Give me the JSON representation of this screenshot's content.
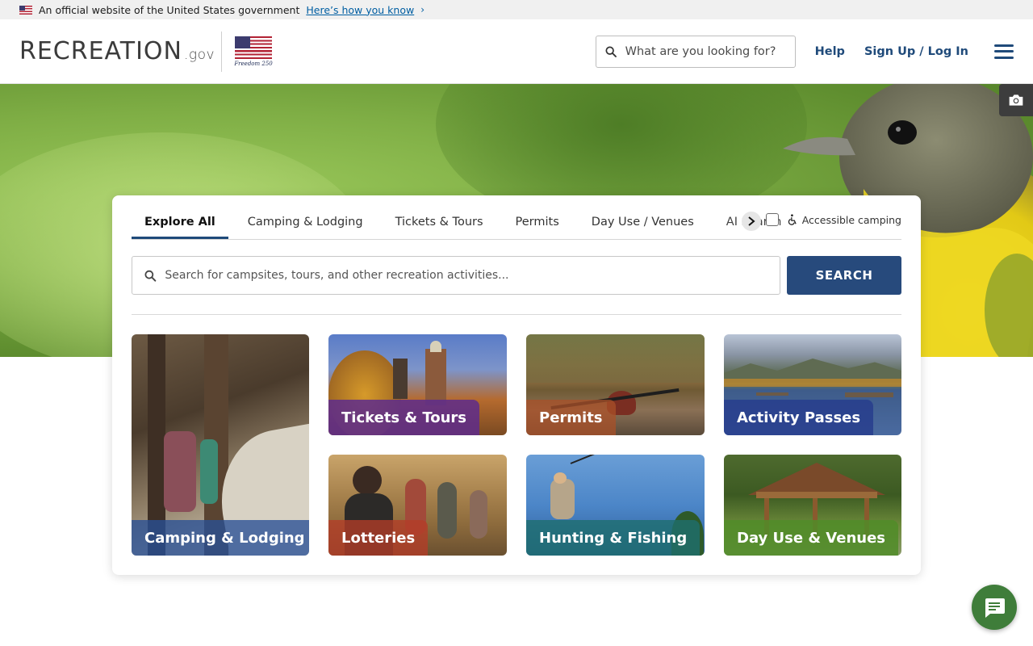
{
  "gov_banner": {
    "text": "An official website of the United States government",
    "link": "Here’s how you know"
  },
  "header": {
    "logo_main": "RECREATION",
    "logo_suffix": ".gov",
    "freedom_label": "Freedom 250",
    "search_placeholder": "What are you looking for?",
    "help": "Help",
    "signup": "Sign Up / Log In"
  },
  "search_card": {
    "tabs": [
      {
        "label": "Explore All",
        "active": true
      },
      {
        "label": "Camping & Lodging"
      },
      {
        "label": "Tickets & Tours"
      },
      {
        "label": "Permits"
      },
      {
        "label": "Day Use / Venues"
      },
      {
        "label": "AI Search"
      }
    ],
    "accessible_label": "Accessible camping",
    "search_placeholder": "Search for campsites, tours, and other recreation activities...",
    "search_button": "SEARCH"
  },
  "categories": [
    {
      "label": "Camping & Lodging"
    },
    {
      "label": "Tickets & Tours"
    },
    {
      "label": "Permits"
    },
    {
      "label": "Activity Passes"
    },
    {
      "label": "Lotteries"
    },
    {
      "label": "Hunting & Fishing"
    },
    {
      "label": "Day Use & Venues"
    }
  ],
  "colors": {
    "brand_navy": "#1f4a7a",
    "search_button": "#274a7c",
    "chat_button": "#3f7d3a"
  },
  "icons": [
    "us-flag-icon",
    "chevron-right-icon",
    "search-icon",
    "hamburger-menu-icon",
    "camera-icon",
    "wheelchair-icon",
    "chat-icon"
  ]
}
